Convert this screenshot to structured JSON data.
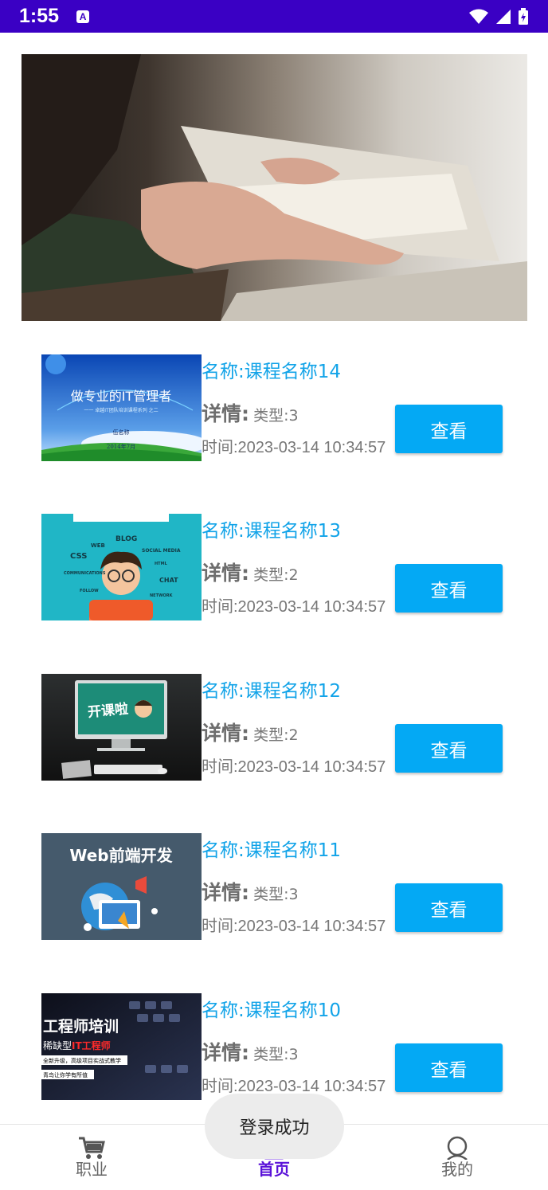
{
  "status_bar": {
    "time": "1:55",
    "a_icon": "A"
  },
  "banner": {
    "image": "photo-hands-reading-book"
  },
  "courses": [
    {
      "name": "名称:课程名称14",
      "detail_label": "详情:",
      "detail_value": "类型:3",
      "time": "时间:2023-03-14 10:34:57",
      "button": "查看",
      "thumb": {
        "title": "做专业的IT管理者",
        "sub1": "一一 卓越IT团队培训课程系列 之二",
        "sub2": "伍名称",
        "sub3": "2014年7月"
      }
    },
    {
      "name": "名称:课程名称13",
      "detail_label": "详情:",
      "detail_value": "类型:2",
      "time": "时间:2023-03-14 10:34:57",
      "button": "查看",
      "thumb": {
        "words": [
          "BLOG",
          "WEB",
          "CSS",
          "SOCIAL MEDIA",
          "HTML",
          "CHAT",
          "COMMUNICATIONS",
          "FOLLOW",
          "NETWORK"
        ]
      }
    },
    {
      "name": "名称:课程名称12",
      "detail_label": "详情:",
      "detail_value": "类型:2",
      "time": "时间:2023-03-14 10:34:57",
      "button": "查看",
      "thumb": {
        "title": "开课啦"
      }
    },
    {
      "name": "名称:课程名称11",
      "detail_label": "详情:",
      "detail_value": "类型:3",
      "time": "时间:2023-03-14 10:34:57",
      "button": "查看",
      "thumb": {
        "title": "Web前端开发"
      }
    },
    {
      "name": "名称:课程名称10",
      "detail_label": "详情:",
      "detail_value": "类型:3",
      "time": "时间:2023-03-14 10:34:57",
      "button": "查看",
      "thumb": {
        "title": "工程师培训",
        "sub1a": "稀缺型",
        "sub1b": "IT工程师",
        "sub2": "全新升级，高级项目实战式教学",
        "sub3": "青鸟让你学有所值"
      }
    }
  ],
  "toast": "登录成功",
  "bottom_nav": [
    {
      "label": "职业",
      "icon": "cart-icon"
    },
    {
      "label": "首页",
      "icon": "home-icon"
    },
    {
      "label": "我的",
      "icon": "person-icon"
    }
  ],
  "colors": {
    "status_bar": "#3a00c4",
    "accent_blue": "#04a9f4",
    "name_blue": "#11a3e8",
    "nav_active": "#5a12d8"
  }
}
